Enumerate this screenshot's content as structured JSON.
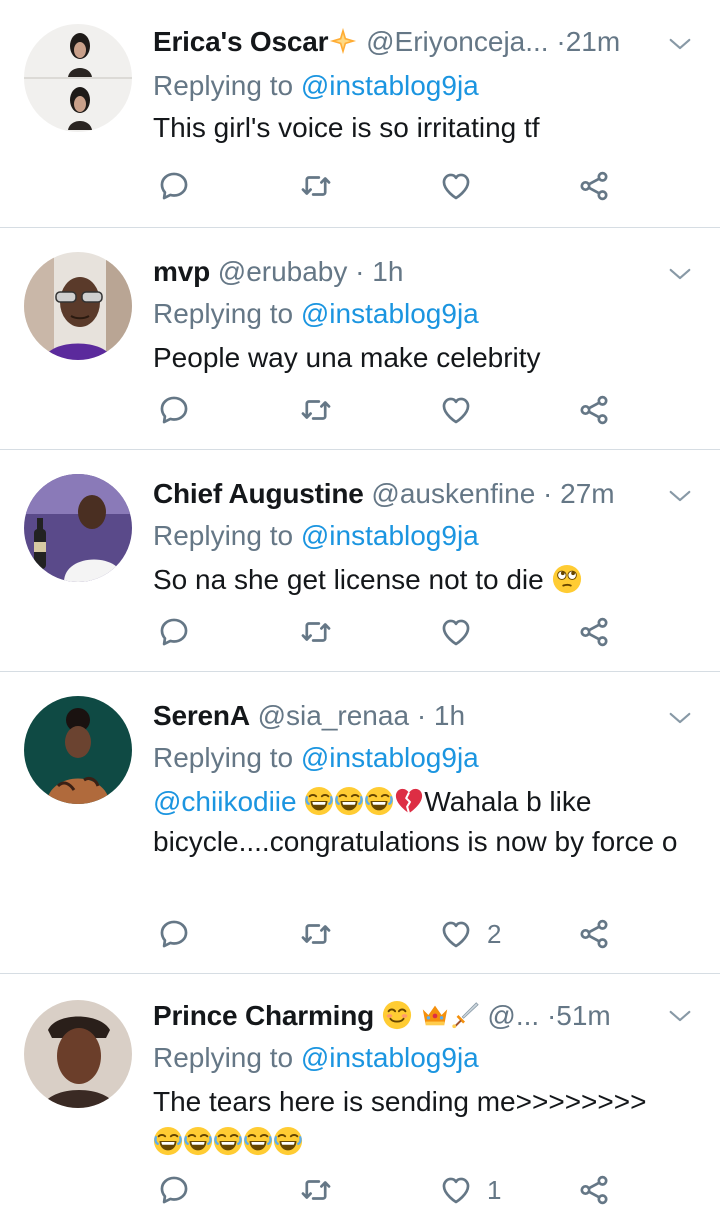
{
  "reply_prefix": "Replying to",
  "tweets": [
    {
      "name": "Erica's Oscar",
      "handle": "@Eriyonceja...",
      "dot": "·",
      "time": "21m",
      "replying_to": "@instablog9ja",
      "body_text": "This girl's voice is so irritating tf",
      "likes": ""
    },
    {
      "name": "mvp",
      "handle": "@erubaby",
      "dot": "·",
      "time": "1h",
      "replying_to": "@instablog9ja",
      "body_text": "People way una make celebrity",
      "likes": ""
    },
    {
      "name": "Chief Augustine",
      "handle": "@auskenfine",
      "dot": "·",
      "time": "27m",
      "replying_to": "@instablog9ja",
      "body_text": "So na she get license not to die",
      "likes": ""
    },
    {
      "name": "SerenA",
      "handle": "@sia_renaa",
      "dot": "·",
      "time": "1h",
      "replying_to": "@instablog9ja",
      "body_mention": "@chiikodiie",
      "body_text": "Wahala b like bicycle....congratulations is now by force o",
      "likes": "2"
    },
    {
      "name": "Prince Charming",
      "handle": "@...",
      "dot": "·",
      "time": "51m",
      "replying_to": "@instablog9ja",
      "body_text": "The tears here is sending me>>>>>>>>",
      "likes": "1"
    }
  ],
  "icons": {
    "reply": "reply-icon",
    "retweet": "retweet-icon",
    "like": "heart-icon",
    "share": "share-icon",
    "more": "chevron-down-icon"
  },
  "colors": {
    "link": "#1b95e0",
    "muted": "#657786",
    "divider": "#d6dde3"
  }
}
